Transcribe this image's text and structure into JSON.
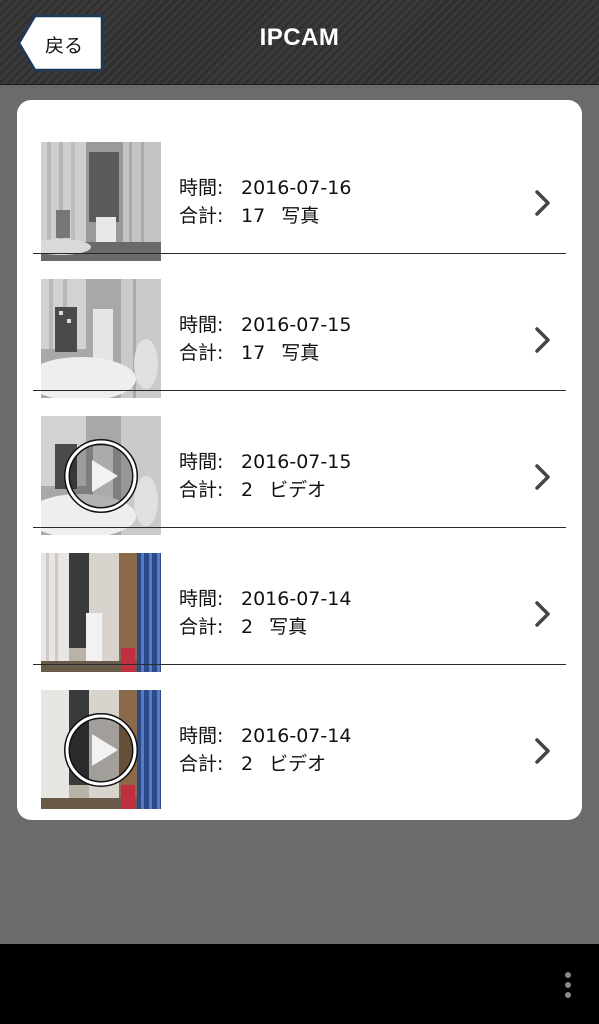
{
  "header": {
    "title": "IPCAM",
    "back_label": "戻る"
  },
  "records": [
    {
      "time_label": "時間:",
      "date": "2016-07-16",
      "total_label": "合計:",
      "count": "17",
      "type": "写真",
      "is_video": false,
      "thumb": "dark-room"
    },
    {
      "time_label": "時間:",
      "date": "2016-07-15",
      "total_label": "合計:",
      "count": "17",
      "type": "写真",
      "is_video": false,
      "thumb": "dark-room"
    },
    {
      "time_label": "時間:",
      "date": "2016-07-15",
      "total_label": "合計:",
      "count": "2",
      "type": "ビデオ",
      "is_video": true,
      "thumb": "dark-room"
    },
    {
      "time_label": "時間:",
      "date": "2016-07-14",
      "total_label": "合計:",
      "count": "2",
      "type": "写真",
      "is_video": false,
      "thumb": "color-room"
    },
    {
      "time_label": "時間:",
      "date": "2016-07-14",
      "total_label": "合計:",
      "count": "2",
      "type": "ビデオ",
      "is_video": true,
      "thumb": "color-room"
    }
  ],
  "icons": {
    "back": "back-arrow-button-icon",
    "chevron": "chevron-right-icon",
    "play": "play-icon",
    "menu": "overflow-menu-icon"
  },
  "colors": {
    "header_bg": "#363636",
    "page_bg": "#6b6b6b",
    "card_bg": "#ffffff",
    "nav_bg": "#000000"
  }
}
